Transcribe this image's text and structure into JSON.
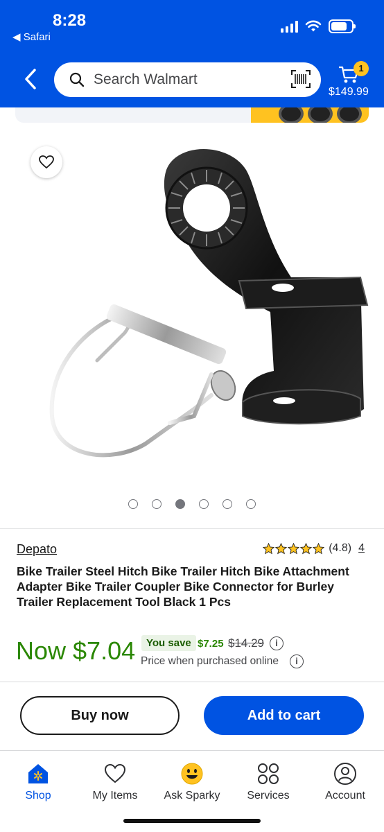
{
  "status_bar": {
    "time": "8:28",
    "back_app": "◀ Safari"
  },
  "header": {
    "search_placeholder": "Search Walmart",
    "cart_count": "1",
    "cart_total": "$149.99",
    "background_color": "#0053e2"
  },
  "gallery": {
    "dot_count": 6,
    "active_index": 2
  },
  "product": {
    "brand": "Depato",
    "rating_value": "(4.8)",
    "stars": 5,
    "review_count": "4",
    "title": "Bike Trailer Steel Hitch Bike Trailer Hitch Bike Attachment Adapter Bike Trailer Coupler Bike Connector for Burley Trailer Replacement Tool Black 1 Pcs",
    "price_now": "Now $7.04",
    "you_save_label": "You save",
    "save_amount": "$7.25",
    "was_price": "$14.29",
    "price_note": "Price when purchased online",
    "price_color": "#2a8703"
  },
  "actions": {
    "buy_now": "Buy now",
    "add_to_cart": "Add to cart"
  },
  "nav": {
    "items": [
      {
        "label": "Shop",
        "icon": "shop-icon",
        "active": true
      },
      {
        "label": "My Items",
        "icon": "heart-icon",
        "active": false
      },
      {
        "label": "Ask Sparky",
        "icon": "sparky-icon",
        "active": false
      },
      {
        "label": "Services",
        "icon": "services-icon",
        "active": false
      },
      {
        "label": "Account",
        "icon": "account-icon",
        "active": false
      }
    ]
  }
}
